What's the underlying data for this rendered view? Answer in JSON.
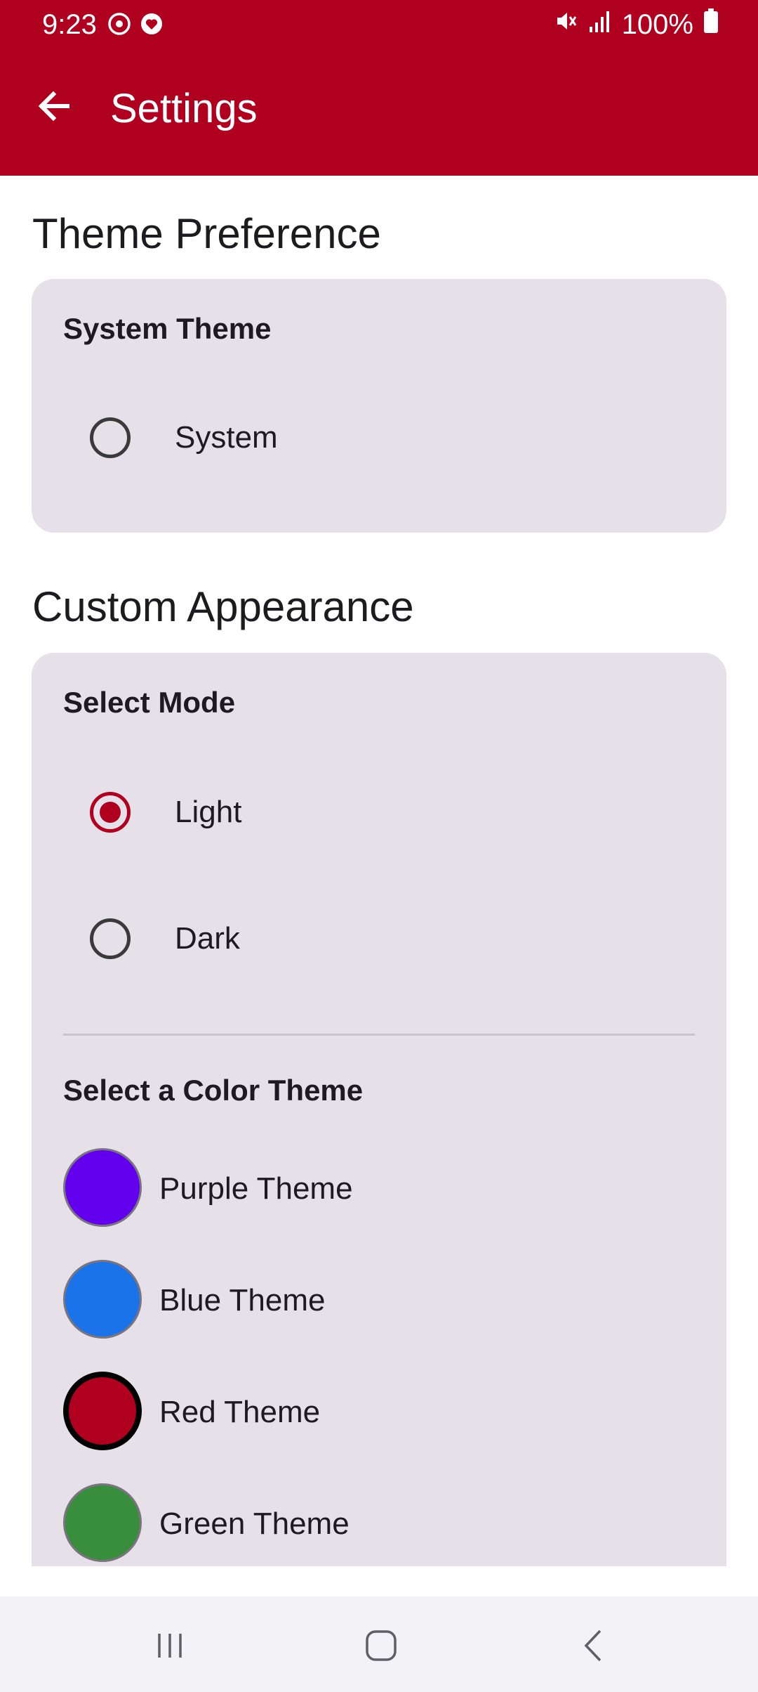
{
  "status_bar": {
    "time": "9:23",
    "battery": "100%",
    "icons": [
      "alarm-sync-icon",
      "heart-app-icon",
      "mute-icon",
      "signal-icon",
      "battery-icon"
    ]
  },
  "app_bar": {
    "title": "Settings",
    "back_icon": "arrow-left-icon",
    "color": "#b00020"
  },
  "theme_preference": {
    "title": "Theme Preference",
    "card_heading": "System Theme",
    "options": [
      {
        "label": "System",
        "selected": false
      }
    ]
  },
  "custom_appearance": {
    "title": "Custom Appearance",
    "mode_heading": "Select Mode",
    "modes": [
      {
        "label": "Light",
        "selected": true
      },
      {
        "label": "Dark",
        "selected": false
      }
    ],
    "color_heading": "Select a Color Theme",
    "colors": [
      {
        "label": "Purple Theme",
        "color": "#6200ee",
        "selected": false
      },
      {
        "label": "Blue Theme",
        "color": "#1a73e8",
        "selected": false
      },
      {
        "label": "Red Theme",
        "color": "#b00020",
        "selected": true
      },
      {
        "label": "Green Theme",
        "color": "#388e3c",
        "selected": false
      }
    ]
  },
  "nav_bar": {
    "icons": [
      "recents-icon",
      "home-icon",
      "back-icon"
    ]
  }
}
